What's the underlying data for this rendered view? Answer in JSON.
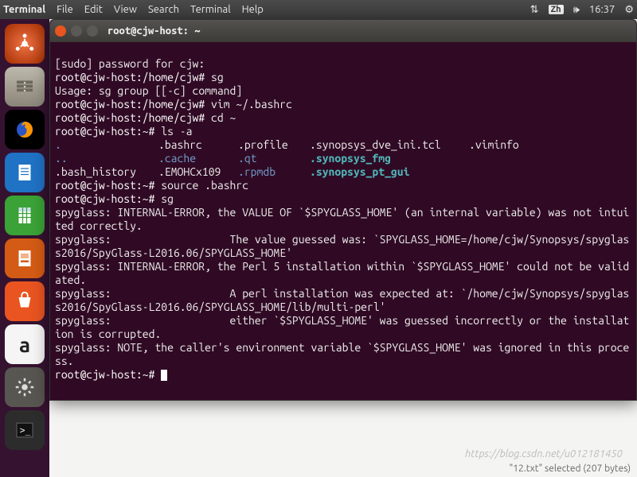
{
  "topbar": {
    "app": "Terminal",
    "menus": [
      "Terminal",
      "File",
      "Edit",
      "View",
      "Search",
      "Terminal",
      "Help"
    ],
    "updown": "⇅",
    "ime": "Zh",
    "sound": "🕪",
    "time": "16:37",
    "gear": "⚙"
  },
  "launcher": {
    "items": [
      {
        "name": "dash",
        "color": "#dd4814"
      },
      {
        "name": "files",
        "color": "#a6a298"
      },
      {
        "name": "firefox",
        "color": "#2b2b2b"
      },
      {
        "name": "writer",
        "color": "#1a6fc4"
      },
      {
        "name": "calc",
        "color": "#3aa236"
      },
      {
        "name": "impress",
        "color": "#e06b1e"
      },
      {
        "name": "software",
        "color": "#e95420"
      },
      {
        "name": "amazon",
        "color": "#f3f3f3"
      },
      {
        "name": "settings",
        "color": "#545454"
      },
      {
        "name": "terminal",
        "color": "#2c2c2c"
      }
    ]
  },
  "window": {
    "title": "root@cjw-host: ~"
  },
  "term": {
    "l1": "[sudo] password for cjw:",
    "p2": "root@cjw-host:/home/cjw#",
    "c2": " sg",
    "l3": "Usage: sg group [[-c] command]",
    "p4": "root@cjw-host:/home/cjw#",
    "c4": " vim ~/.bashrc",
    "p5": "root@cjw-host:/home/cjw#",
    "c5": " cd ~",
    "p6": "root@cjw-host:~#",
    "c6": " ls -a",
    "ls": {
      "r1": {
        "a": ".",
        "b": ".bashrc",
        "c": ".profile",
        "d": ".synopsys_dve_ini.tcl",
        "e": ".viminfo"
      },
      "r2": {
        "a": "..",
        "b": ".cache",
        "c": ".qt",
        "d": ".synopsys_fmg"
      },
      "r3": {
        "a": ".bash_history",
        "b": ".EMOHCx109",
        "c": ".rpmdb",
        "d": ".synopsys_pt_gui"
      }
    },
    "p7": "root@cjw-host:~#",
    "c7": " source .bashrc",
    "p8": "root@cjw-host:~#",
    "c8": " sg",
    "l9": "spyglass: INTERNAL-ERROR, the VALUE OF `$SPYGLASS_HOME' (an internal variable) was not intuited correctly.",
    "l10": "spyglass:                   The value guessed was: `SPYGLASS_HOME=/home/cjw/Synopsys/spyglass2016/SpyGlass-L2016.06/SPYGLASS_HOME'",
    "l11": "spyglass: INTERNAL-ERROR, the Perl 5 installation within `$SPYGLASS_HOME' could not be validated.",
    "l12": "spyglass:                   A perl installation was expected at: `/home/cjw/Synopsys/spyglass2016/SpyGlass-L2016.06/SPYGLASS_HOME/lib/multi-perl'",
    "l13": "spyglass:                   either `$SPYGLASS_HOME' was guessed incorrectly or the installation is corrupted.",
    "l14": "spyglass: NOTE, the caller's environment variable `$SPYGLASS_HOME' was ignored in this process.",
    "p15": "root@cjw-host:~#"
  },
  "status": "\"12.txt\" selected (207 bytes)",
  "watermark": "https://blog.csdn.net/u012181450"
}
